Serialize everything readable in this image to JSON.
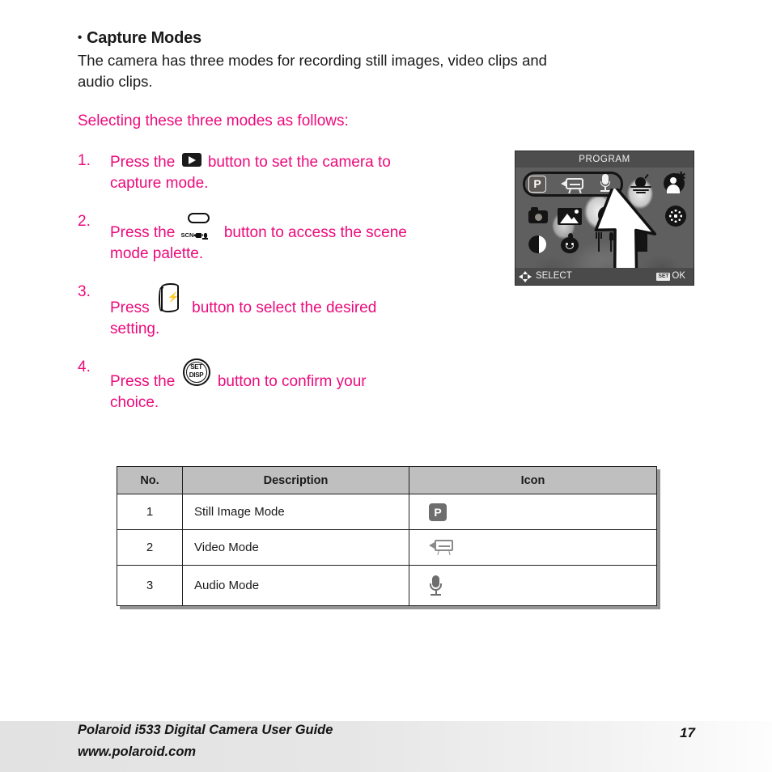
{
  "heading": {
    "bullet": "•",
    "title": "Capture Modes"
  },
  "intro": {
    "line1": "The camera has three modes for recording still images, video clips and",
    "line2": "audio clips."
  },
  "selecting": "Selecting these three modes as follows:",
  "steps": [
    {
      "num": "1.",
      "before": "Press the",
      "icon": "playback-button-icon",
      "after": "button to set the camera to",
      "line2": "capture mode."
    },
    {
      "num": "2.",
      "before": "Press the",
      "icon": "scene-mode-button-icon",
      "icon_label": "SCN",
      "after": "button to access the scene",
      "line2": "mode palette."
    },
    {
      "num": "3.",
      "before": "Press",
      "icon": "flash-rocker-button-icon",
      "after": "button to select the desired",
      "line2": "setting."
    },
    {
      "num": "4.",
      "before": "Press the",
      "icon": "set-disp-button-icon",
      "icon_line1": "SET",
      "icon_line2": "DISP",
      "after": "button to confirm your",
      "line2": "choice."
    }
  ],
  "lcd": {
    "title": "PROGRAM",
    "highlighted_row": [
      "still-image-mode-icon",
      "video-mode-icon",
      "audio-mode-icon"
    ],
    "scene_icons": [
      "sunset-mode-icon",
      "night-portrait-mode-icon",
      "camera-mode-icon",
      "landscape-mode-icon",
      "sports-mode-icon",
      "fireworks-mode-icon",
      "night-mode-icon",
      "kids-mode-icon",
      "food-mode-icon",
      "building-mode-icon"
    ],
    "p_label": "P",
    "footer": {
      "select_label": "SELECT",
      "ok_key": "SET",
      "ok_label": "OK"
    }
  },
  "table": {
    "headers": [
      "No.",
      "Description",
      "Icon"
    ],
    "rows": [
      {
        "no": "1",
        "description": "Still Image Mode",
        "icon": "still-image-mode-icon",
        "icon_label": "P"
      },
      {
        "no": "2",
        "description": "Video Mode",
        "icon": "video-mode-icon",
        "icon_label": ""
      },
      {
        "no": "3",
        "description": "Audio Mode",
        "icon": "audio-mode-icon",
        "icon_label": ""
      }
    ]
  },
  "footer": {
    "guide": "Polaroid i533 Digital Camera User Guide",
    "website": "www.polaroid.com",
    "page_number": "17"
  },
  "colors": {
    "accent_pink": "#EC0A7B",
    "body_text": "#1a1a1a",
    "table_header_bg": "#bfbfbf",
    "lcd_title_bg": "#4d4d4d",
    "icon_gray": "#6e6e6e"
  }
}
